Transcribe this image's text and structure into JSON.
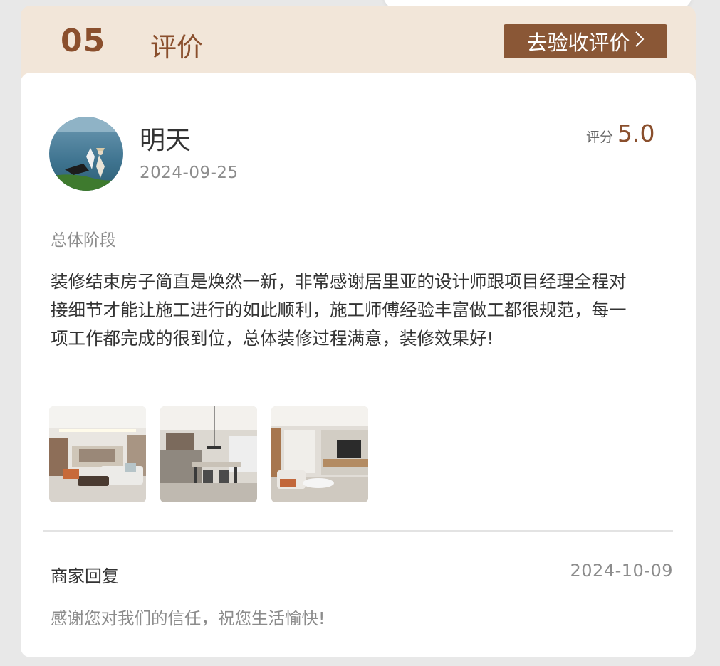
{
  "section": {
    "number": "05",
    "title": "评价",
    "action_label": "去验收评价",
    "action_icon": "chevron-right-icon",
    "accent_color": "#8a5736"
  },
  "review": {
    "user_name": "明天",
    "date": "2024-09-25",
    "score_label": "评分",
    "score": "5.0",
    "stage": "总体阶段",
    "content": "装修结束房子简直是焕然一新，非常感谢居里亚的设计师跟项目经理全程对接细节才能让施工进行的如此顺利，施工师傅经验丰富做工都很规范，每一项工作都完成的很到位，总体装修过程满意，装修效果好!",
    "photos": [
      {
        "icon": "living-room-photo"
      },
      {
        "icon": "dining-room-photo"
      },
      {
        "icon": "lounge-photo"
      }
    ]
  },
  "reply": {
    "label": "商家回复",
    "date": "2024-10-09",
    "content": "感谢您对我们的信任，祝您生活愉快!"
  }
}
